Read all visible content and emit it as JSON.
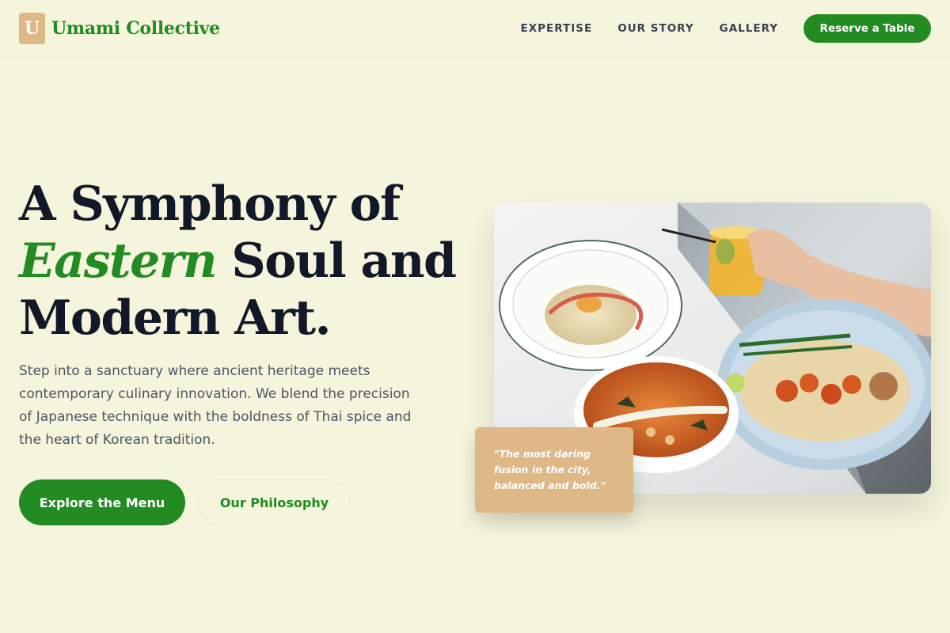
{
  "brand": {
    "logo_letter": "U",
    "name": "Umami Collective"
  },
  "nav": {
    "items": [
      {
        "label": "EXPERTISE"
      },
      {
        "label": "OUR STORY"
      },
      {
        "label": "GALLERY"
      }
    ],
    "cta_label": "Reserve a Table"
  },
  "hero": {
    "title_line1": "A Symphony of",
    "title_accent": "Eastern",
    "title_line2_rest": " Soul and",
    "title_line3": "Modern Art.",
    "description": "Step into a sanctuary where ancient heritage meets contemporary culinary innovation. We blend the precision of Japanese technique with the boldness of Thai spice and the heart of Korean tradition.",
    "primary_button": "Explore the Menu",
    "secondary_button": "Our Philosophy"
  },
  "quote": {
    "text": "\"The most daring fusion in the city, balanced and bold.\""
  },
  "colors": {
    "background": "#f5f4dc",
    "brand_green": "#228b22",
    "accent_tan": "#deb887",
    "heading": "#111827",
    "body_text": "#4b5563"
  }
}
